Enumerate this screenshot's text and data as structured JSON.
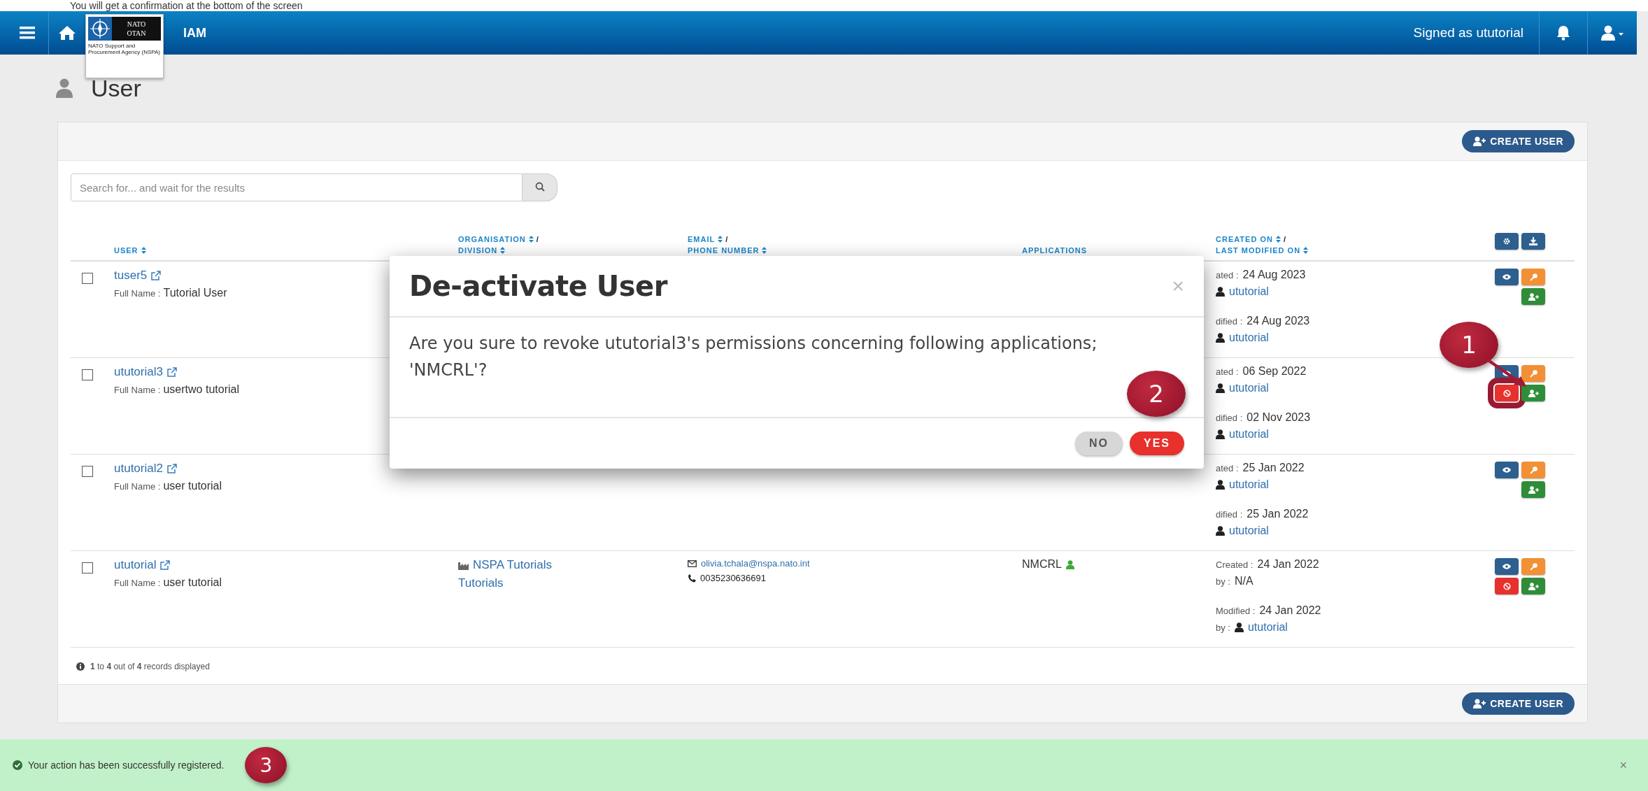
{
  "caption": "You will get a confirmation at the bottom of the screen",
  "navbar": {
    "app_name": "IAM",
    "logo": {
      "lines": [
        "NATO",
        "OTAN"
      ],
      "caption": "NATO Support and Procurement Agency (NSPA)"
    },
    "signed_in": "Signed as ututorial"
  },
  "page_title": "User",
  "top_bar": {
    "button": "CREATE USER"
  },
  "search": {
    "placeholder": "Search for... and wait for the results"
  },
  "table": {
    "columns": [
      {
        "lines": [
          {
            "text": "USER",
            "sortable": true
          }
        ]
      },
      {
        "lines": [
          {
            "text": "ORGANISATION",
            "sortable": true,
            "suffix": "/"
          },
          {
            "text": "DIVISION",
            "sortable": true
          }
        ]
      },
      {
        "lines": [
          {
            "text": "EMAIL",
            "sortable": true,
            "suffix": "/"
          },
          {
            "text": "PHONE NUMBER",
            "sortable": true
          }
        ]
      },
      {
        "lines": [
          {
            "text": "APPLICATIONS",
            "sortable": false
          }
        ]
      },
      {
        "lines": [
          {
            "text": "CREATED ON",
            "sortable": true,
            "suffix": "/"
          },
          {
            "text": "LAST MODIFIED ON",
            "sortable": true
          }
        ]
      }
    ],
    "rows": [
      {
        "checked": false,
        "user": "tuser5",
        "full_name_label": "Full Name :",
        "full_name": "Tutorial User",
        "created": {
          "label": "ated :",
          "date": "24 Aug 2023",
          "by": {
            "kind": "user",
            "name": "ututorial"
          }
        },
        "modified": {
          "label": "dified :",
          "date": "24 Aug 2023",
          "by": {
            "kind": "user",
            "name": "ututorial"
          }
        },
        "actions": [
          {
            "kind": "view",
            "highlighted": false
          },
          {
            "kind": "reset",
            "highlighted": false
          },
          {
            "kind": "assign",
            "highlighted": false
          }
        ]
      },
      {
        "checked": false,
        "user": "ututorial3",
        "full_name_label": "Full Name :",
        "full_name": "usertwo tutorial",
        "created": {
          "label": "ated :",
          "date": "06 Sep 2022",
          "by": {
            "kind": "user",
            "name": "ututorial"
          }
        },
        "modified": {
          "label": "dified :",
          "date": "02 Nov 2023",
          "by": {
            "kind": "user",
            "name": "ututorial"
          }
        },
        "actions": [
          {
            "kind": "view",
            "highlighted": false
          },
          {
            "kind": "reset",
            "highlighted": false
          },
          {
            "kind": "deactivate",
            "highlighted": true
          },
          {
            "kind": "assign",
            "highlighted": false
          }
        ]
      },
      {
        "checked": false,
        "user": "ututorial2",
        "full_name_label": "Full Name :",
        "full_name": "user tutorial",
        "created": {
          "label": "ated :",
          "date": "25 Jan 2022",
          "by": {
            "kind": "user",
            "name": "ututorial"
          }
        },
        "modified": {
          "label": "dified :",
          "date": "25 Jan 2022",
          "by": {
            "kind": "user",
            "name": "ututorial"
          }
        },
        "actions": [
          {
            "kind": "view",
            "highlighted": false
          },
          {
            "kind": "reset",
            "highlighted": false
          },
          {
            "kind": "assign",
            "highlighted": false
          }
        ]
      },
      {
        "checked": false,
        "user": "ututorial",
        "full_name_label": "Full Name :",
        "full_name": "user tutorial",
        "organisation": "NSPA Tutorials",
        "division": "Tutorials",
        "email": "olivia.tchala@nspa.nato.int",
        "phone": "0035230636691",
        "applications": [
          {
            "name": "NMCRL"
          }
        ],
        "created": {
          "label": "Created :",
          "date": "24 Jan 2022",
          "by_label": "by :",
          "by": {
            "kind": "text",
            "name": "N/A"
          }
        },
        "modified": {
          "label": "Modified :",
          "date": "24 Jan 2022",
          "by_label": "by :",
          "by": {
            "kind": "user",
            "name": "ututorial"
          }
        },
        "actions": [
          {
            "kind": "view",
            "highlighted": false
          },
          {
            "kind": "reset",
            "highlighted": false
          },
          {
            "kind": "deactivate",
            "highlighted": false
          },
          {
            "kind": "assign",
            "highlighted": false
          }
        ]
      }
    ]
  },
  "records_info": "**1** to **4** out of **4** records displayed",
  "bottom_bar": {
    "button": "CREATE USER"
  },
  "modal": {
    "title": "De-activate User",
    "close": "×",
    "message": "Are you sure to revoke ututorial3's permissions concerning following applications; 'NMCRL'?",
    "buttons": [
      {
        "label": "NO",
        "kind": "secondary"
      },
      {
        "label": "YES",
        "kind": "danger"
      }
    ]
  },
  "toast": {
    "message": "Your action has been successfully registered.",
    "close": "×"
  },
  "annotations": [
    {
      "number": "1"
    },
    {
      "number": "2"
    },
    {
      "number": "3"
    }
  ]
}
